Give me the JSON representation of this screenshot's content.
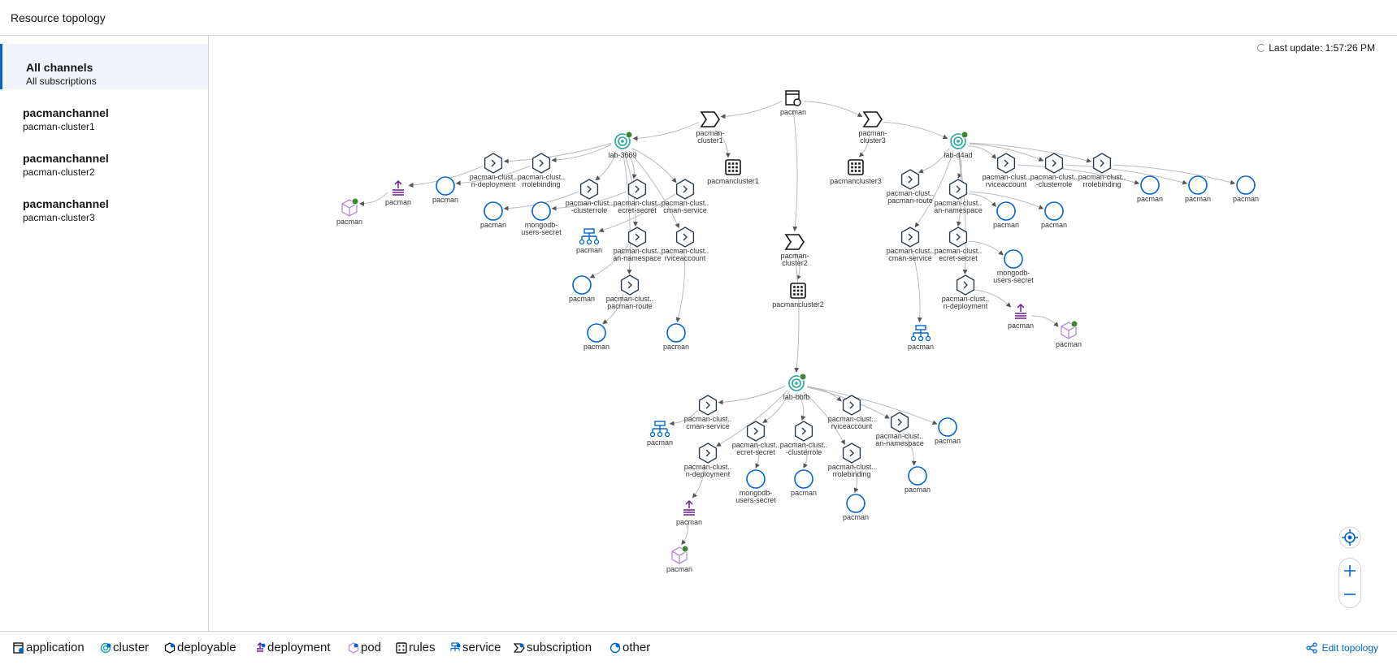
{
  "header": {
    "title": "Resource topology"
  },
  "sidebar": {
    "channels": [
      {
        "name": "All channels",
        "sub": "All subscriptions",
        "active": true
      },
      {
        "name": "pacmanchannel",
        "sub": "pacman-cluster1"
      },
      {
        "name": "pacmanchannel",
        "sub": "pacman-cluster2"
      },
      {
        "name": "pacmanchannel",
        "sub": "pacman-cluster3"
      }
    ]
  },
  "status": {
    "last_update": "Last update: 1:57:26 PM"
  },
  "colors": {
    "accent": "#0066cc",
    "cluster": "#1fa79c",
    "deployment": "#6a1b9a",
    "pod": "#b58cd9",
    "ok": "#3e8635",
    "node": "#2b3a4a"
  },
  "topology": {
    "nodes": [
      {
        "id": "app",
        "type": "application",
        "labels": [
          "pacman"
        ],
        "color": "#151515"
      },
      {
        "id": "sub1",
        "type": "subscription",
        "labels": [
          "pacman-",
          "cluster1"
        ],
        "color": "#151515"
      },
      {
        "id": "sub2",
        "type": "subscription",
        "labels": [
          "pacman-",
          "cluster2"
        ],
        "color": "#151515"
      },
      {
        "id": "sub3",
        "type": "subscription",
        "labels": [
          "pacman-",
          "cluster3"
        ],
        "color": "#151515"
      },
      {
        "id": "r1",
        "type": "rules",
        "labels": [
          "pacmancluster1"
        ],
        "color": "#151515"
      },
      {
        "id": "r2",
        "type": "rules",
        "labels": [
          "pacmancluster2"
        ],
        "color": "#151515"
      },
      {
        "id": "r3",
        "type": "rules",
        "labels": [
          "pacmancluster3"
        ],
        "color": "#151515"
      },
      {
        "id": "c1",
        "type": "cluster",
        "labels": [
          "lab-3669"
        ],
        "color": "#1fa79c"
      },
      {
        "id": "c3",
        "type": "cluster",
        "labels": [
          "lab-d4ad"
        ],
        "color": "#1fa79c"
      },
      {
        "id": "c2",
        "type": "cluster",
        "labels": [
          "lab-bbfb"
        ],
        "color": "#1fa79c"
      },
      {
        "id": "a_dep",
        "type": "deployable",
        "labels": [
          "pacman-clust..",
          "n-deployment"
        ],
        "color": "#2b3a4a"
      },
      {
        "id": "a_rb",
        "type": "deployable",
        "labels": [
          "pacman-clust..",
          "rrolebinding"
        ],
        "color": "#2b3a4a"
      },
      {
        "id": "a_cr",
        "type": "deployable",
        "labels": [
          "pacman-clust..",
          "-clusterrole"
        ],
        "color": "#2b3a4a"
      },
      {
        "id": "a_sec",
        "type": "deployable",
        "labels": [
          "pacman-clust..",
          "ecret-secret"
        ],
        "color": "#2b3a4a"
      },
      {
        "id": "a_svc",
        "type": "deployable",
        "labels": [
          "pacman-clust..",
          "cman-service"
        ],
        "color": "#2b3a4a"
      },
      {
        "id": "a_ns",
        "type": "deployable",
        "labels": [
          "pacman-clust..",
          "an-namespace"
        ],
        "color": "#2b3a4a"
      },
      {
        "id": "a_sa",
        "type": "deployable",
        "labels": [
          "pacman-clust..",
          "rviceaccount"
        ],
        "color": "#2b3a4a"
      },
      {
        "id": "a_rt",
        "type": "deployable",
        "labels": [
          "pacman-clust..",
          "pacman-route"
        ],
        "color": "#2b3a4a"
      },
      {
        "id": "a_depl",
        "type": "deployment",
        "labels": [
          "pacman"
        ],
        "color": "#6a1b9a"
      },
      {
        "id": "a_pod",
        "type": "pod",
        "labels": [
          "pacman"
        ],
        "color": "#b58cd9"
      },
      {
        "id": "a_o1",
        "type": "other",
        "labels": [
          "pacman"
        ],
        "color": "#0066cc"
      },
      {
        "id": "a_o2",
        "type": "other",
        "labels": [
          "pacman"
        ],
        "color": "#0066cc"
      },
      {
        "id": "a_ms",
        "type": "other",
        "labels": [
          "mongodb-",
          "users-secret"
        ],
        "color": "#0066cc"
      },
      {
        "id": "a_svcn",
        "type": "service",
        "labels": [
          "pacman"
        ],
        "color": "#0066cc"
      },
      {
        "id": "a_o3",
        "type": "other",
        "labels": [
          "pacman"
        ],
        "color": "#0066cc"
      },
      {
        "id": "a_o4",
        "type": "other",
        "labels": [
          "pacman"
        ],
        "color": "#0066cc"
      },
      {
        "id": "a_o5",
        "type": "other",
        "labels": [
          "pacman"
        ],
        "color": "#0066cc"
      },
      {
        "id": "b_rt",
        "type": "deployable",
        "labels": [
          "pacman-clust..",
          "pacman-route"
        ],
        "color": "#2b3a4a"
      },
      {
        "id": "b_ns",
        "type": "deployable",
        "labels": [
          "pacman-clust..",
          "an-namespace"
        ],
        "color": "#2b3a4a"
      },
      {
        "id": "b_sa",
        "type": "deployable",
        "labels": [
          "pacman-clust..",
          "rviceaccount"
        ],
        "color": "#2b3a4a"
      },
      {
        "id": "b_cr",
        "type": "deployable",
        "labels": [
          "pacman-clust..",
          "-clusterrole"
        ],
        "color": "#2b3a4a"
      },
      {
        "id": "b_rb",
        "type": "deployable",
        "labels": [
          "pacman-clust..",
          "rrolebinding"
        ],
        "color": "#2b3a4a"
      },
      {
        "id": "b_svc",
        "type": "deployable",
        "labels": [
          "pacman-clust..",
          "cman-service"
        ],
        "color": "#2b3a4a"
      },
      {
        "id": "b_sec",
        "type": "deployable",
        "labels": [
          "pacman-clust..",
          "ecret-secret"
        ],
        "color": "#2b3a4a"
      },
      {
        "id": "b_dep",
        "type": "deployable",
        "labels": [
          "pacman-clust..",
          "n-deployment"
        ],
        "color": "#2b3a4a"
      },
      {
        "id": "b_o1",
        "type": "other",
        "labels": [
          "pacman"
        ],
        "color": "#0066cc"
      },
      {
        "id": "b_o2",
        "type": "other",
        "labels": [
          "pacman"
        ],
        "color": "#0066cc"
      },
      {
        "id": "b_o3",
        "type": "other",
        "labels": [
          "pacman"
        ],
        "color": "#0066cc"
      },
      {
        "id": "b_o4",
        "type": "other",
        "labels": [
          "pacman"
        ],
        "color": "#0066cc"
      },
      {
        "id": "b_o5",
        "type": "other",
        "labels": [
          "pacman"
        ],
        "color": "#0066cc"
      },
      {
        "id": "b_ms",
        "type": "other",
        "labels": [
          "mongodb-",
          "users-secret"
        ],
        "color": "#0066cc"
      },
      {
        "id": "b_svcn",
        "type": "service",
        "labels": [
          "pacman"
        ],
        "color": "#0066cc"
      },
      {
        "id": "b_depl",
        "type": "deployment",
        "labels": [
          "pacman"
        ],
        "color": "#6a1b9a"
      },
      {
        "id": "b_pod",
        "type": "pod",
        "labels": [
          "pacman"
        ],
        "color": "#b58cd9"
      },
      {
        "id": "c_svc",
        "type": "deployable",
        "labels": [
          "pacman-clust..",
          "cman-service"
        ],
        "color": "#2b3a4a"
      },
      {
        "id": "c_sa",
        "type": "deployable",
        "labels": [
          "pacman-clust..",
          "rviceaccount"
        ],
        "color": "#2b3a4a"
      },
      {
        "id": "c_ns",
        "type": "deployable",
        "labels": [
          "pacman-clust..",
          "an-namespace"
        ],
        "color": "#2b3a4a"
      },
      {
        "id": "c_sec",
        "type": "deployable",
        "labels": [
          "pacman-clust..",
          "ecret-secret"
        ],
        "color": "#2b3a4a"
      },
      {
        "id": "c_cr",
        "type": "deployable",
        "labels": [
          "pacman-clust..",
          "-clusterrole"
        ],
        "color": "#2b3a4a"
      },
      {
        "id": "c_dep",
        "type": "deployable",
        "labels": [
          "pacman-clust..",
          "n-deployment"
        ],
        "color": "#2b3a4a"
      },
      {
        "id": "c_rb",
        "type": "deployable",
        "labels": [
          "pacman-clust..",
          "rrolebinding"
        ],
        "color": "#2b3a4a"
      },
      {
        "id": "c_svcn",
        "type": "service",
        "labels": [
          "pacman"
        ],
        "color": "#0066cc"
      },
      {
        "id": "c_o1",
        "type": "other",
        "labels": [
          "pacman"
        ],
        "color": "#0066cc"
      },
      {
        "id": "c_o2",
        "type": "other",
        "labels": [
          "pacman"
        ],
        "color": "#0066cc"
      },
      {
        "id": "c_ms",
        "type": "other",
        "labels": [
          "mongodb-",
          "users-secret"
        ],
        "color": "#0066cc"
      },
      {
        "id": "c_o3",
        "type": "other",
        "labels": [
          "pacman"
        ],
        "color": "#0066cc"
      },
      {
        "id": "c_o4",
        "type": "other",
        "labels": [
          "pacman"
        ],
        "color": "#0066cc"
      },
      {
        "id": "c_depl",
        "type": "deployment",
        "labels": [
          "pacman"
        ],
        "color": "#6a1b9a"
      },
      {
        "id": "c_pod",
        "type": "pod",
        "labels": [
          "pacman"
        ],
        "color": "#b58cd9"
      }
    ],
    "edges": [
      [
        "app",
        "sub1"
      ],
      [
        "app",
        "sub2"
      ],
      [
        "app",
        "sub3"
      ],
      [
        "sub1",
        "r1"
      ],
      [
        "sub2",
        "r2"
      ],
      [
        "sub3",
        "r3"
      ],
      [
        "sub1",
        "c1"
      ],
      [
        "sub3",
        "c3"
      ],
      [
        "sub2",
        "c2"
      ],
      [
        "c1",
        "a_dep"
      ],
      [
        "c1",
        "a_rb"
      ],
      [
        "c1",
        "a_cr"
      ],
      [
        "c1",
        "a_sec"
      ],
      [
        "c1",
        "a_svc"
      ],
      [
        "c1",
        "a_ns"
      ],
      [
        "c1",
        "a_sa"
      ],
      [
        "c1",
        "a_rt"
      ],
      [
        "a_dep",
        "a_depl"
      ],
      [
        "a_depl",
        "a_pod"
      ],
      [
        "a_rb",
        "a_o1"
      ],
      [
        "a_cr",
        "a_o2"
      ],
      [
        "a_sec",
        "a_ms"
      ],
      [
        "a_svc",
        "a_svcn"
      ],
      [
        "a_ns",
        "a_o3"
      ],
      [
        "a_rt",
        "a_o4"
      ],
      [
        "a_sa",
        "a_o5"
      ],
      [
        "c3",
        "b_rt"
      ],
      [
        "c3",
        "b_ns"
      ],
      [
        "c3",
        "b_sa"
      ],
      [
        "c3",
        "b_cr"
      ],
      [
        "c3",
        "b_rb"
      ],
      [
        "c3",
        "b_svc"
      ],
      [
        "c3",
        "b_sec"
      ],
      [
        "c3",
        "b_dep"
      ],
      [
        "b_sa",
        "b_o1"
      ],
      [
        "b_cr",
        "b_o2"
      ],
      [
        "b_rb",
        "b_o3"
      ],
      [
        "b_ns",
        "b_o4"
      ],
      [
        "b_ns",
        "b_o5"
      ],
      [
        "b_sec",
        "b_ms"
      ],
      [
        "b_svc",
        "b_svcn"
      ],
      [
        "b_dep",
        "b_depl"
      ],
      [
        "b_depl",
        "b_pod"
      ],
      [
        "c2",
        "c_svc"
      ],
      [
        "c2",
        "c_sa"
      ],
      [
        "c2",
        "c_ns"
      ],
      [
        "c2",
        "c_sec"
      ],
      [
        "c2",
        "c_cr"
      ],
      [
        "c2",
        "c_dep"
      ],
      [
        "c2",
        "c_rb"
      ],
      [
        "c2",
        "c_o4"
      ],
      [
        "c_svc",
        "c_svcn"
      ],
      [
        "c_sec",
        "c_ms"
      ],
      [
        "c_cr",
        "c_o1"
      ],
      [
        "c_rb",
        "c_o2"
      ],
      [
        "c_ns",
        "c_o3"
      ],
      [
        "c_dep",
        "c_depl"
      ],
      [
        "c_depl",
        "c_pod"
      ]
    ]
  },
  "legend": {
    "items": [
      {
        "label": "application",
        "icon": "application-icon"
      },
      {
        "label": "cluster",
        "icon": "cluster-icon"
      },
      {
        "label": "deployable",
        "icon": "deployable-icon"
      },
      {
        "label": "deployment",
        "icon": "deployment-icon"
      },
      {
        "label": "pod",
        "icon": "pod-icon"
      },
      {
        "label": "rules",
        "icon": "rules-icon"
      },
      {
        "label": "service",
        "icon": "service-icon"
      },
      {
        "label": "subscription",
        "icon": "subscription-icon"
      },
      {
        "label": "other",
        "icon": "other-icon"
      }
    ],
    "edit_label": "Edit topology"
  }
}
